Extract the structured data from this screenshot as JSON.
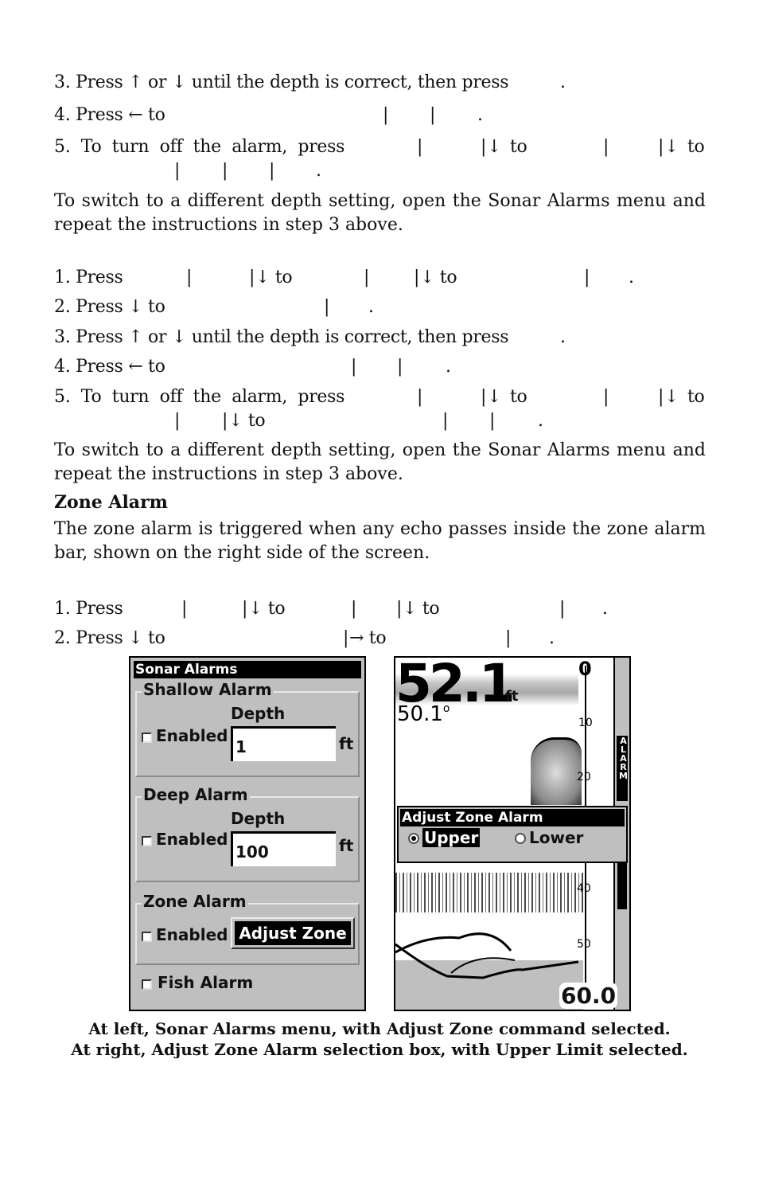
{
  "section1": {
    "step3": "3. Press ↑ or ↓ until the depth is correct, then press",
    "step4": "4. Press ← to",
    "step5_prefix": "5.  To  turn  off  the  alarm,  press",
    "step5_to": "to",
    "separator": "|",
    "down_arrow": "↓",
    "period": "."
  },
  "para1": "To switch to a different depth setting, open the Sonar Alarms menu and repeat the instructions in step 3 above.",
  "section2": {
    "step1": "1. Press",
    "step2": "2. Press ↓ to",
    "step3": "3. Press ↑ or ↓ until the depth is correct, then press",
    "step4": "4. Press ← to",
    "step5_prefix": "5.  To  turn  off  the  alarm,  press",
    "to": "to",
    "down_to": "↓ to"
  },
  "para2": "To switch to a different depth setting, open the Sonar Alarms menu and repeat the instructions in step 3 above.",
  "zone_heading": "Zone Alarm",
  "zone_para": "The zone alarm is triggered when any echo passes inside the zone alarm bar, shown on the right side of the screen.",
  "section3": {
    "step1": "1. Press",
    "step2": "2. Press ↓ to",
    "right_to": "→ to",
    "down_to": "↓ to"
  },
  "left_screen": {
    "title": "Sonar Alarms",
    "shallow": {
      "label": "Shallow Alarm",
      "depth_label": "Depth",
      "enabled_label": "Enabled",
      "enabled": false,
      "value": "1",
      "unit": "ft"
    },
    "deep": {
      "label": "Deep Alarm",
      "depth_label": "Depth",
      "enabled_label": "Enabled",
      "enabled": false,
      "value": "100",
      "unit": "ft"
    },
    "zone": {
      "label": "Zone Alarm",
      "enabled_label": "Enabled",
      "enabled": false,
      "button": "Adjust Zone"
    },
    "fish": {
      "label": "Fish Alarm",
      "enabled": false
    }
  },
  "right_screen": {
    "depth": "52.1",
    "depth_unit": "ft",
    "temperature": "50.1",
    "temp_unit": "o",
    "scale_ticks": [
      "0",
      "10",
      "20",
      "40",
      "50"
    ],
    "bottom_depth": "60.0",
    "alarm_tag": "ALARM",
    "dialog": {
      "title": "Adjust Zone Alarm",
      "options": [
        {
          "label": "Upper",
          "selected": true
        },
        {
          "label": "Lower",
          "selected": false
        }
      ]
    }
  },
  "caption": {
    "line1": "At left, Sonar Alarms menu, with Adjust Zone command selected.",
    "line2": "At right, Adjust Zone Alarm selection box, with Upper Limit selected."
  }
}
